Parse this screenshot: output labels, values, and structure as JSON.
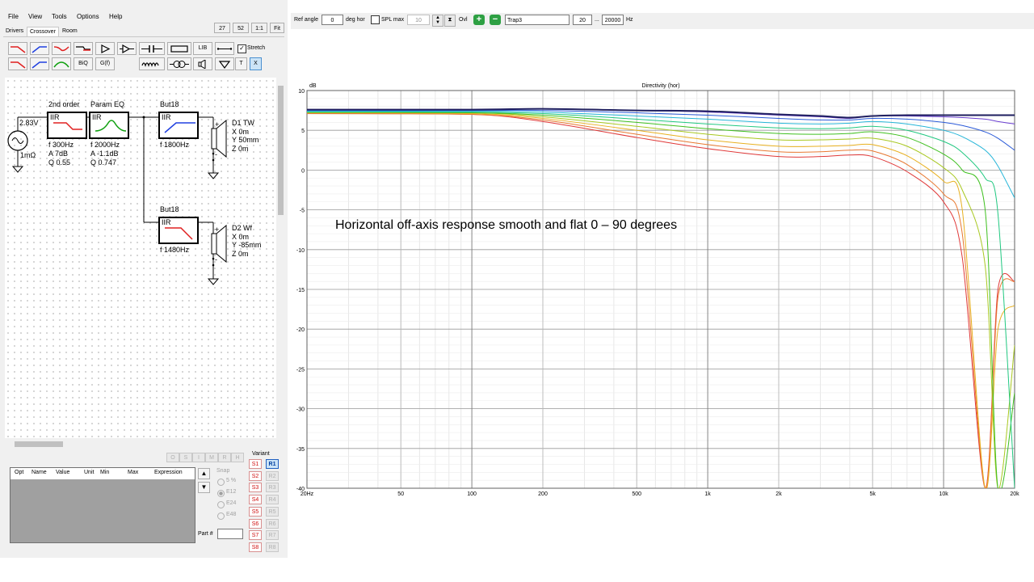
{
  "menu": [
    "File",
    "View",
    "Tools",
    "Options",
    "Help"
  ],
  "zoom_buttons": [
    "27",
    "52",
    "1:1",
    "Fit"
  ],
  "tabs": [
    "Drivers",
    "Crossover",
    "Room"
  ],
  "toolbar": {
    "biq": "BiQ",
    "gf": "G(f)",
    "lib": "LIB",
    "t": "T",
    "x": "X",
    "stretch": "Stretch"
  },
  "schematic": {
    "source": {
      "voltage": "2.83V",
      "impedance": "1mΩ"
    },
    "blocks": [
      {
        "title": "2nd order",
        "type": "IIR",
        "p1": "f  300Hz",
        "p2": "A  7dB",
        "p3": "Q  0.55"
      },
      {
        "title": "Param EQ",
        "type": "IIR",
        "p1": "f  2000Hz",
        "p2": "A  -1.1dB",
        "p3": "Q  0.747"
      },
      {
        "title": "But18",
        "type": "IIR",
        "p1": "f  1800Hz"
      },
      {
        "title": "But18",
        "type": "IIR",
        "p1": "f  1480Hz"
      }
    ],
    "drivers": [
      {
        "name": "D1 TW",
        "x": "X 0m",
        "y": "Y 50mm",
        "z": "Z 0m"
      },
      {
        "name": "D2 Wf",
        "x": "X 0m",
        "y": "Y -85mm",
        "z": "Z 0m"
      }
    ]
  },
  "opt_table": {
    "headers": [
      "Opt",
      "Name",
      "Value",
      "Unit",
      "Min",
      "Max",
      "Expression"
    ]
  },
  "opt_buttons": [
    "O",
    "S",
    "I",
    "M",
    "R",
    "H"
  ],
  "snap": {
    "label": "Snap",
    "options": [
      "5 %",
      "E12",
      "E24",
      "E48"
    ]
  },
  "part_label": "Part #",
  "variant": {
    "label": "Variant",
    "s": [
      "S1",
      "S2",
      "S3",
      "S4",
      "S5",
      "S6",
      "S7",
      "S8"
    ],
    "r": [
      "R1",
      "R2",
      "R3",
      "R4",
      "R5",
      "R6",
      "R7",
      "R8"
    ]
  },
  "top": {
    "ref_angle_label": "Ref angle",
    "ref_angle": "0",
    "deg_label": "deg hor",
    "spl_max_label": "SPL max",
    "spl_max": "10",
    "ovl_label": "Ovl",
    "overlay_name": "Trap3",
    "f_min": "20",
    "f_sep": "...",
    "f_max": "20000",
    "hz": "Hz"
  },
  "annotation": "Horizontal off-axis response smooth and flat 0 – 90 degrees",
  "chart_data": {
    "type": "line",
    "title": "Directivity (hor)",
    "ylabel": "dB",
    "xscale": "log",
    "xlim": [
      20,
      20000
    ],
    "ylim": [
      -40,
      10
    ],
    "yticks": [
      10,
      5,
      0,
      -5,
      -10,
      -15,
      -20,
      -25,
      -30,
      -35,
      -40
    ],
    "xticks": [
      {
        "v": 20,
        "l": "20Hz"
      },
      {
        "v": 50,
        "l": "50"
      },
      {
        "v": 100,
        "l": "100"
      },
      {
        "v": 200,
        "l": "200"
      },
      {
        "v": 500,
        "l": "500"
      },
      {
        "v": 1000,
        "l": "1k"
      },
      {
        "v": 2000,
        "l": "2k"
      },
      {
        "v": 5000,
        "l": "5k"
      },
      {
        "v": 10000,
        "l": "10k"
      },
      {
        "v": 20000,
        "l": "20k"
      }
    ],
    "grid": true,
    "x": [
      20,
      100,
      200,
      500,
      1000,
      2000,
      3000,
      4000,
      5000,
      7000,
      10000,
      12000,
      15000,
      17000,
      20000
    ],
    "series": [
      {
        "color": "#202060",
        "values": [
          7.6,
          7.6,
          7.7,
          7.5,
          7.4,
          7.0,
          6.8,
          6.6,
          6.8,
          6.9,
          6.9,
          6.9,
          6.9,
          6.9,
          6.9
        ]
      },
      {
        "color": "#6a3fd0",
        "values": [
          7.6,
          7.6,
          7.7,
          7.5,
          7.3,
          6.9,
          6.7,
          6.5,
          6.8,
          6.8,
          6.7,
          6.6,
          6.4,
          6.1,
          5.8
        ]
      },
      {
        "color": "#2a5ad8",
        "values": [
          7.5,
          7.5,
          7.5,
          7.2,
          6.9,
          6.5,
          6.3,
          6.3,
          6.5,
          6.4,
          6.0,
          5.6,
          4.8,
          4.0,
          2.5
        ]
      },
      {
        "color": "#25b5d8",
        "values": [
          7.4,
          7.4,
          7.3,
          6.8,
          6.4,
          5.9,
          5.8,
          5.9,
          6.1,
          5.8,
          5.0,
          4.2,
          2.5,
          0.5,
          -3.5
        ]
      },
      {
        "color": "#20c880",
        "values": [
          7.3,
          7.3,
          7.1,
          6.4,
          5.8,
          5.3,
          5.2,
          5.3,
          5.5,
          5.0,
          3.6,
          2.2,
          -1.0,
          -5.5,
          -40
        ]
      },
      {
        "color": "#3fc020",
        "values": [
          7.3,
          7.2,
          6.9,
          6.0,
          5.2,
          4.6,
          4.5,
          4.6,
          4.8,
          4.1,
          2.0,
          0.0,
          -5.0,
          -40,
          -28
        ]
      },
      {
        "color": "#a8c820",
        "values": [
          7.2,
          7.2,
          6.7,
          5.5,
          4.5,
          3.8,
          3.8,
          3.9,
          4.0,
          3.0,
          0.3,
          -2.5,
          -12.0,
          -40,
          -22
        ]
      },
      {
        "color": "#e8b020",
        "values": [
          7.2,
          7.1,
          6.5,
          5.0,
          3.8,
          3.0,
          3.0,
          3.1,
          3.2,
          1.8,
          -1.4,
          -5.0,
          -40,
          -20,
          -17
        ]
      },
      {
        "color": "#e87830",
        "values": [
          7.1,
          7.0,
          6.3,
          4.5,
          3.2,
          2.3,
          2.3,
          2.5,
          2.4,
          0.7,
          -3.0,
          -8.0,
          -40,
          -16,
          -14
        ]
      },
      {
        "color": "#e03838",
        "values": [
          7.1,
          7.0,
          6.1,
          4.1,
          2.7,
          1.7,
          1.7,
          1.9,
          1.7,
          -0.2,
          -4.0,
          -11.0,
          -40,
          -15,
          -14
        ]
      }
    ]
  }
}
